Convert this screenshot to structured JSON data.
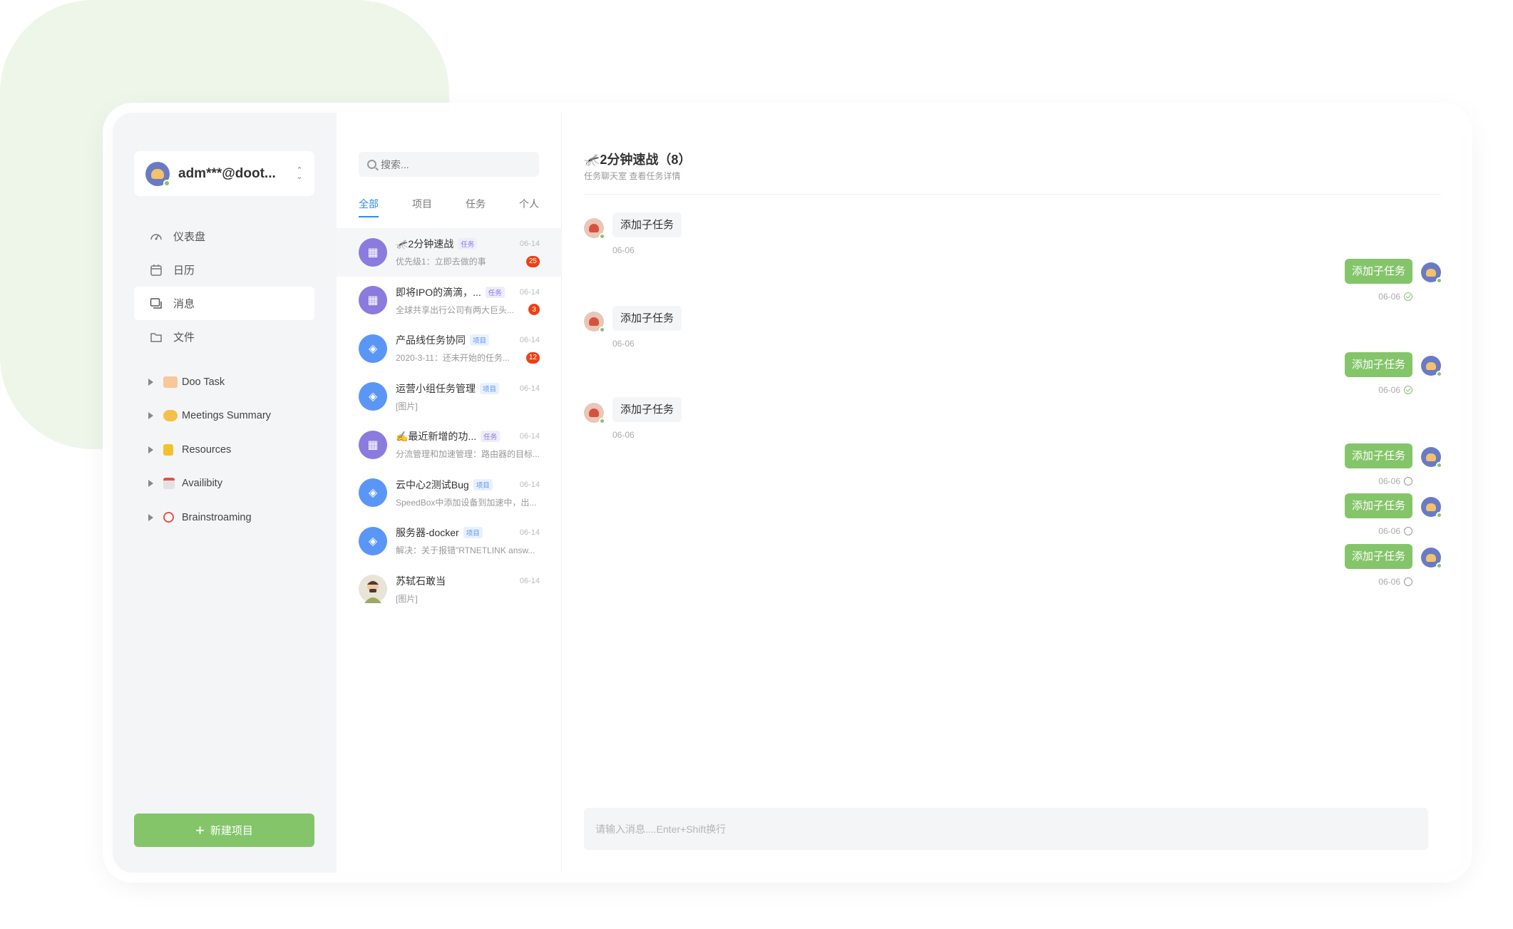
{
  "account": {
    "name": "adm***@doot..."
  },
  "nav": [
    {
      "label": "仪表盘",
      "icon": "dashboard-icon"
    },
    {
      "label": "日历",
      "icon": "calendar-icon"
    },
    {
      "label": "消息",
      "icon": "message-icon",
      "active": true
    },
    {
      "label": "文件",
      "icon": "folder-icon"
    }
  ],
  "projects": [
    {
      "label": "Doo Task"
    },
    {
      "label": "Meetings Summary"
    },
    {
      "label": "Resources"
    },
    {
      "label": "Availibity"
    },
    {
      "label": "Brainstroaming"
    }
  ],
  "new_project": "新建项目",
  "search": {
    "placeholder": "搜索..."
  },
  "tabs": [
    "全部",
    "项目",
    "任务",
    "个人"
  ],
  "threads": [
    {
      "title": "🦟2分钟速战",
      "tag": "任务",
      "date": "06-14",
      "preview": "优先级1：立即去做的事",
      "badge": "25"
    },
    {
      "title": "即将IPO的滴滴，...",
      "tag": "任务",
      "date": "06-14",
      "preview": "全球共享出行公司有两大巨头...",
      "badge": "3"
    },
    {
      "title": "产品线任务协同",
      "tag": "项目",
      "date": "06-14",
      "preview": "2020-3-11：还未开始的任务...",
      "badge": "12"
    },
    {
      "title": "运营小组任务管理",
      "tag": "项目",
      "date": "06-14",
      "preview": "[图片]"
    },
    {
      "title": "✍️最近新增的功...",
      "tag": "任务",
      "date": "06-14",
      "preview": "分流管理和加速管理：路由器的目标..."
    },
    {
      "title": "云中心2测试Bug",
      "tag": "项目",
      "date": "06-14",
      "preview": "SpeedBox中添加设备到加速中，出..."
    },
    {
      "title": "服务器-docker",
      "tag": "项目",
      "date": "06-14",
      "preview": "解决：关于报错\"RTNETLINK answ..."
    },
    {
      "title": "苏轼石敢当",
      "date": "06-14",
      "preview": "[图片]"
    }
  ],
  "chat": {
    "title": "🦟2分钟速战（8）",
    "subtitle": "任务聊天室 查看任务详情",
    "messages": [
      {
        "text": "添加子任务",
        "time": "06-06"
      },
      {
        "text": "添加子任务",
        "time": "06-06"
      },
      {
        "text": "添加子任务",
        "time": "06-06"
      },
      {
        "text": "添加子任务",
        "time": "06-06"
      },
      {
        "text": "添加子任务",
        "time": "06-06"
      },
      {
        "text": "添加子任务",
        "time": "06-06"
      },
      {
        "text": "添加子任务",
        "time": "06-06"
      },
      {
        "text": "添加子任务",
        "time": "06-06"
      }
    ],
    "input_placeholder": "请输入消息....Enter+Shift换行"
  },
  "colors": {
    "accent": "#84c56a",
    "link": "#2d8cf0",
    "badge": "#ed4014"
  }
}
